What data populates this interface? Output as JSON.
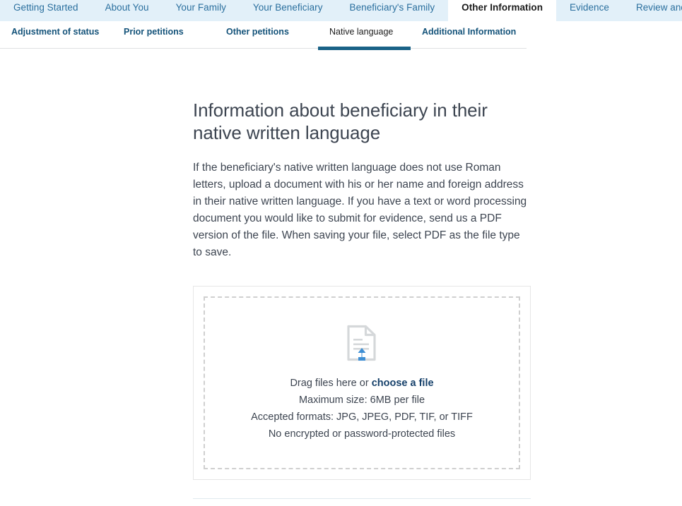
{
  "topnav": {
    "items": [
      {
        "label": "Getting Started",
        "active": false
      },
      {
        "label": "About You",
        "active": false
      },
      {
        "label": "Your Family",
        "active": false
      },
      {
        "label": "Your Beneficiary",
        "active": false
      },
      {
        "label": "Beneficiary's Family",
        "active": false
      },
      {
        "label": "Other Information",
        "active": true
      },
      {
        "label": "Evidence",
        "active": false
      },
      {
        "label": "Review and Submit",
        "active": false
      }
    ]
  },
  "subnav": {
    "items": [
      {
        "label": "Adjustment of status",
        "active": false
      },
      {
        "label": "Prior petitions",
        "active": false
      },
      {
        "label": "Other petitions",
        "active": false
      },
      {
        "label": "Native language",
        "active": true
      },
      {
        "label": "Additional Information",
        "active": false
      }
    ]
  },
  "main": {
    "title": "Information about beneficiary in their native written language",
    "intro": "If the beneficiary's native written language does not use Roman letters, upload a document with his or her name and foreign address in their native written language. If you have a text or word processing document you would like to submit for evidence, send us a PDF version of the file. When saving your file, select PDF as the file type to save."
  },
  "upload": {
    "icon": "document-upload-icon",
    "drag_text": "Drag files here or ",
    "choose_file_label": "choose a file",
    "max_size": "Maximum size: 6MB per file",
    "accepted_formats": "Accepted formats: JPG, JPEG, PDF, TIF, or TIFF",
    "encryption_note": "No encrypted or password-protected files"
  },
  "colors": {
    "nav_background": "#e2f0f9",
    "nav_link": "#2a6f9e",
    "active_underline": "#1a6287",
    "subnav_label": "#14537a",
    "body_text": "#3d4551",
    "link": "#15406a",
    "icon_blue": "#3f8fd4",
    "icon_gray": "#d5d8da"
  }
}
